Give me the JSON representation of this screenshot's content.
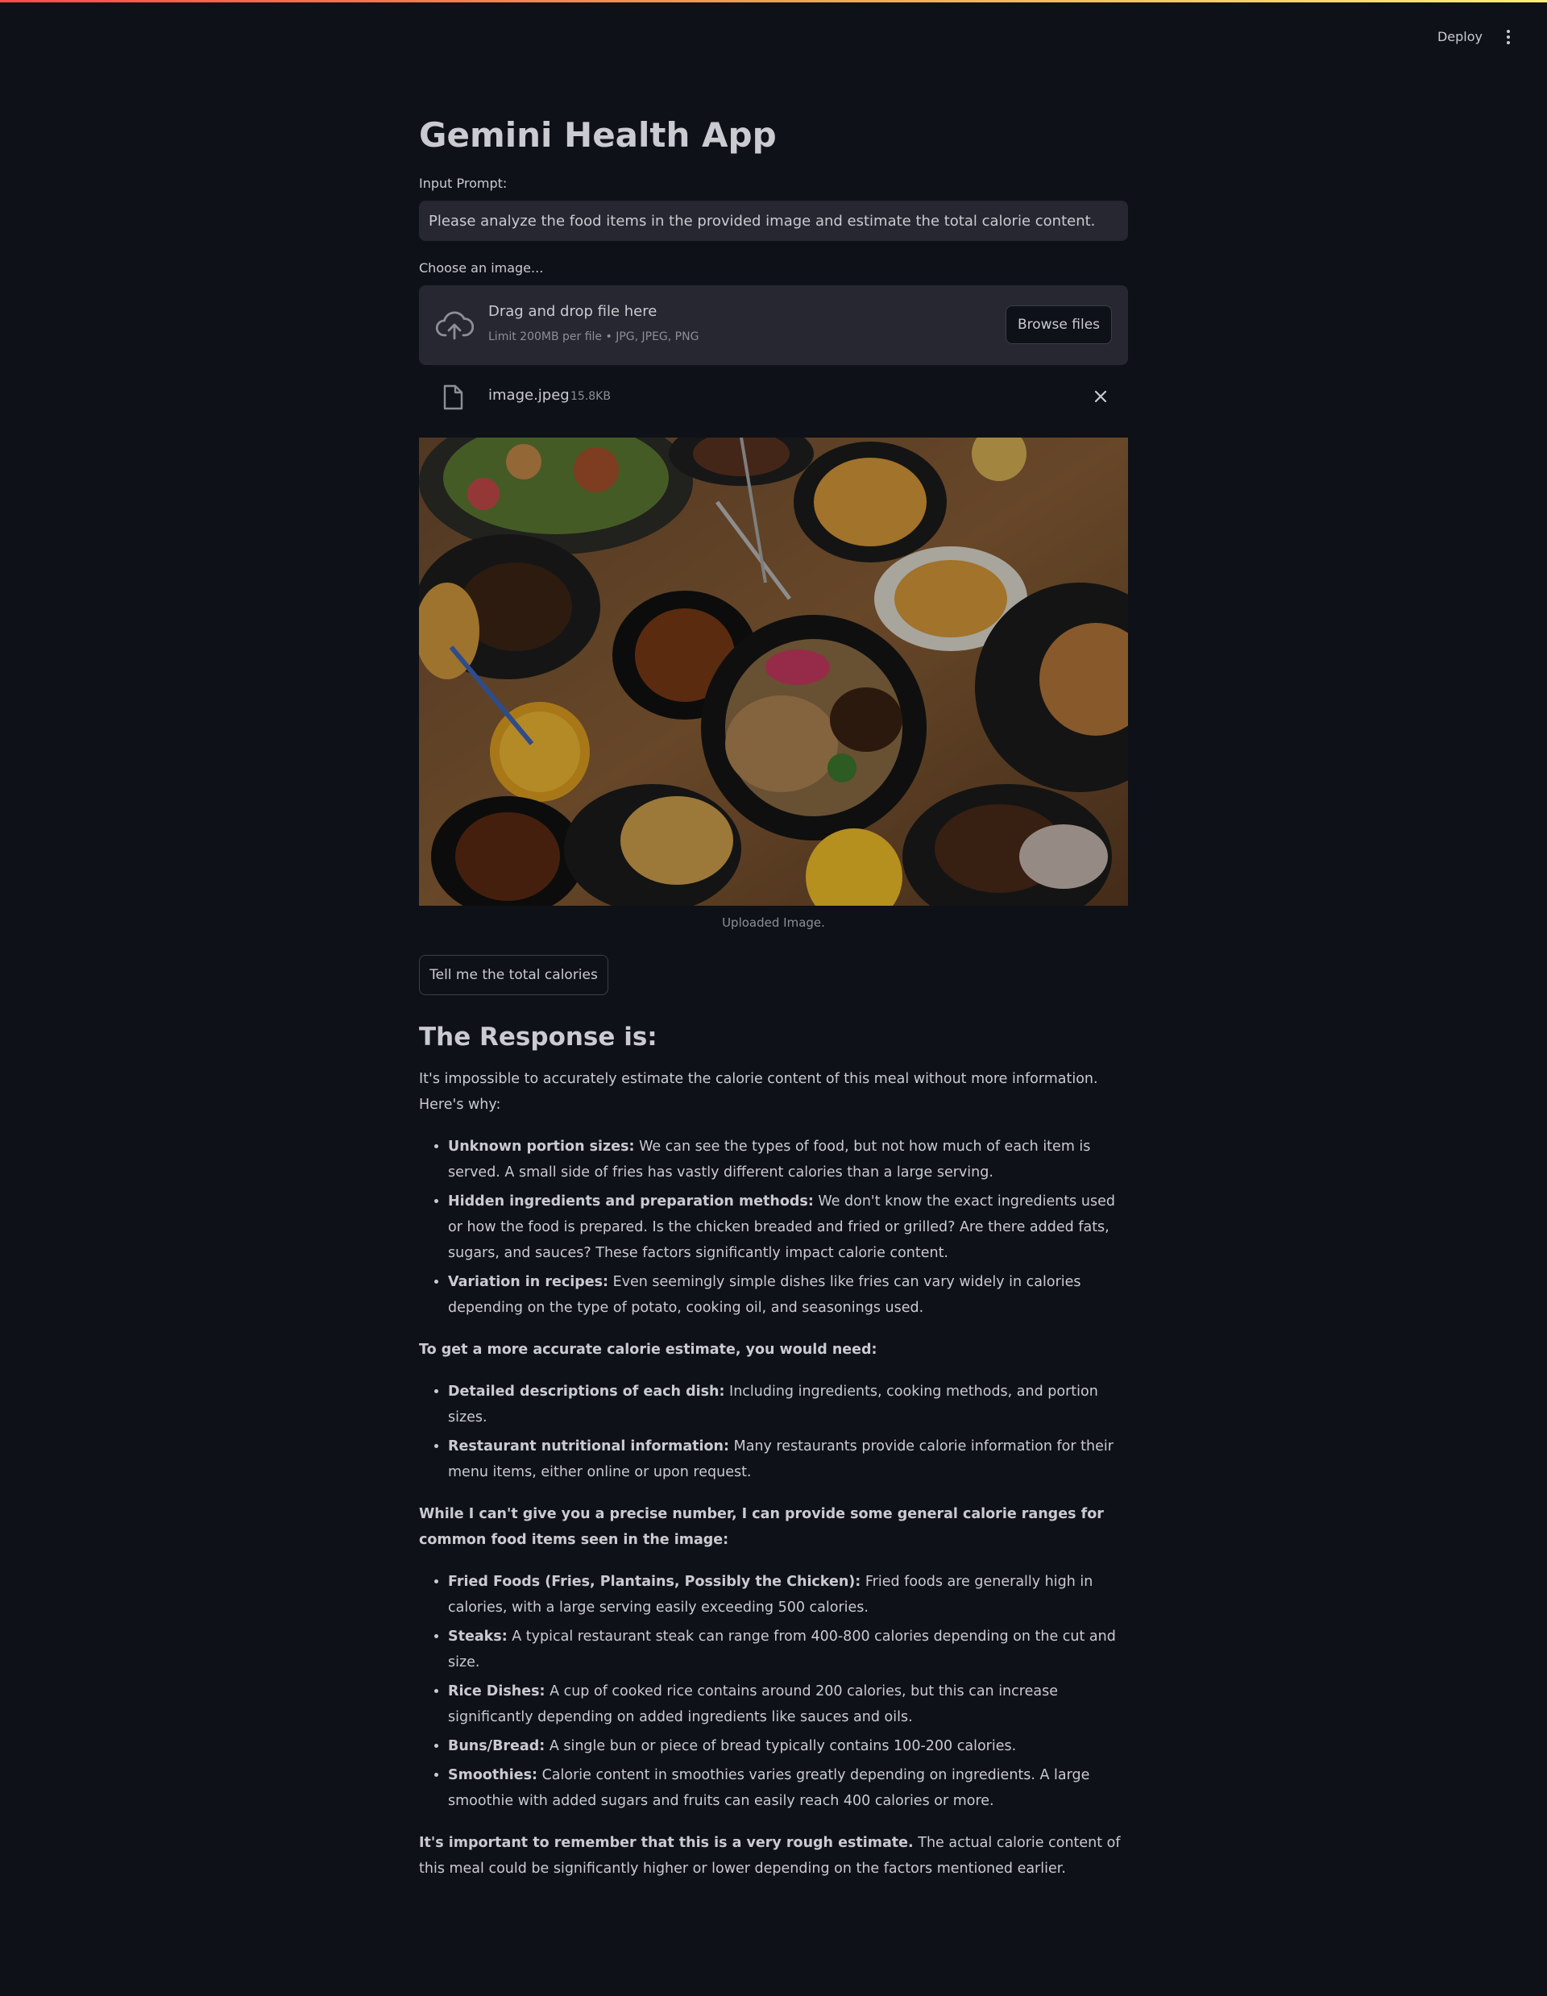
{
  "header": {
    "deploy_label": "Deploy",
    "menu_icon": "vertical-dots-icon"
  },
  "app": {
    "title": "Gemini Health App"
  },
  "prompt": {
    "label": "Input Prompt:",
    "value": "Please analyze the food items in the provided image and estimate the total calorie content."
  },
  "uploader": {
    "label": "Choose an image...",
    "drop_text": "Drag and drop file here",
    "limit_text": "Limit 200MB per file • JPG, JPEG, PNG",
    "browse_label": "Browse files",
    "upload_icon": "cloud-upload-icon",
    "file": {
      "name": "image.jpeg",
      "size": "15.8KB",
      "file_icon": "file-icon",
      "remove_icon": "close-icon"
    }
  },
  "image": {
    "caption": "Uploaded Image."
  },
  "action": {
    "button_label": "Tell me the total calories"
  },
  "response": {
    "heading": "The Response is:",
    "intro": "It's impossible to accurately estimate the calorie content of this meal without more information. Here's why:",
    "reasons": [
      {
        "title": "Unknown portion sizes:",
        "text": " We can see the types of food, but not how much of each item is served. A small side of fries has vastly different calories than a large serving."
      },
      {
        "title": "Hidden ingredients and preparation methods:",
        "text": " We don't know the exact ingredients used or how the food is prepared. Is the chicken breaded and fried or grilled? Are there added fats, sugars, and sauces? These factors significantly impact calorie content."
      },
      {
        "title": "Variation in recipes:",
        "text": " Even seemingly simple dishes like fries can vary widely in calories depending on the type of potato, cooking oil, and seasonings used."
      }
    ],
    "need_heading": "To get a more accurate calorie estimate, you would need:",
    "needs": [
      {
        "title": "Detailed descriptions of each dish:",
        "text": " Including ingredients, cooking methods, and portion sizes."
      },
      {
        "title": "Restaurant nutritional information:",
        "text": " Many restaurants provide calorie information for their menu items, either online or upon request."
      }
    ],
    "ranges_heading": "While I can't give you a precise number, I can provide some general calorie ranges for common food items seen in the image:",
    "ranges": [
      {
        "title": "Fried Foods (Fries, Plantains, Possibly the Chicken):",
        "text": " Fried foods are generally high in calories, with a large serving easily exceeding 500 calories."
      },
      {
        "title": "Steaks:",
        "text": " A typical restaurant steak can range from 400-800 calories depending on the cut and size."
      },
      {
        "title": "Rice Dishes:",
        "text": " A cup of cooked rice contains around 200 calories, but this can increase significantly depending on added ingredients like sauces and oils."
      },
      {
        "title": "Buns/Bread:",
        "text": " A single bun or piece of bread typically contains 100-200 calories."
      },
      {
        "title": "Smoothies:",
        "text": " Calorie content in smoothies varies greatly depending on ingredients. A large smoothie with added sugars and fruits can easily reach 400 calories or more."
      }
    ],
    "closing_bold": "It's important to remember that this is a very rough estimate.",
    "closing_text": " The actual calorie content of this meal could be significantly higher or lower depending on the factors mentioned earlier."
  }
}
